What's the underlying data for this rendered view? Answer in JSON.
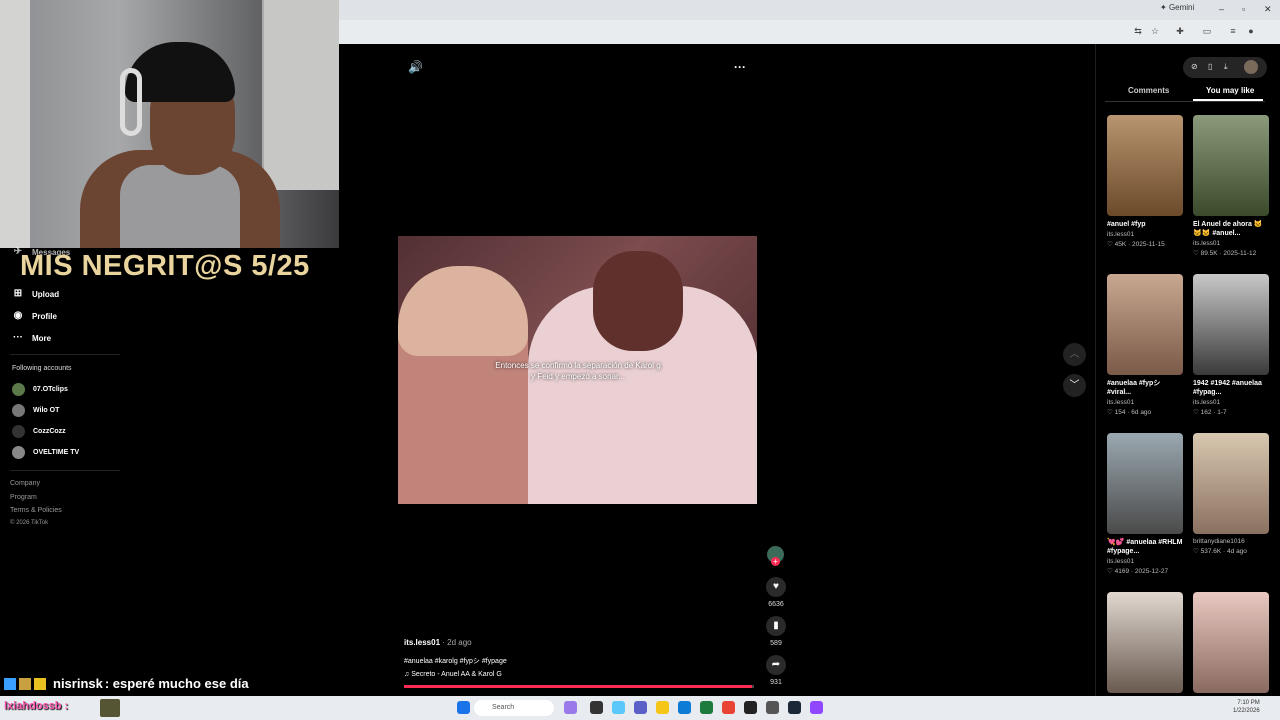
{
  "browser": {
    "gemini_label": "Gemini",
    "minimize": "–",
    "maximize": "▫",
    "close": "✕"
  },
  "stream": {
    "overlay_title": "MIS NEGRIT@S 5/25",
    "chat_user": "nisrinsk",
    "chat_message": ": esperé mucho ese día",
    "taskbar_user": "lxiahdossb :"
  },
  "sidebar": {
    "messages": "Messages",
    "items": [
      {
        "label": "Upload",
        "icon": "upload-icon"
      },
      {
        "label": "Profile",
        "icon": "avatar-icon"
      },
      {
        "label": "More",
        "icon": "more-icon"
      }
    ],
    "following_heading": "Following accounts",
    "accounts": [
      "07.OTclips",
      "Wilo OT",
      "CozzCozz",
      "OVELTIME TV"
    ],
    "footer": [
      "Company",
      "Program",
      "Terms & Policies",
      "© 2026 TikTok"
    ]
  },
  "video": {
    "caption": "Entonces se confirmó la separación de Karol g y Feid y empezó a sonar...",
    "author": "its.less01",
    "posted": "· 2d ago",
    "hashtags": "#anuelaa #karolg #fypシ #fypage",
    "music": "♫  Secreto - Anuel AA & Karol G",
    "progress": 0.995,
    "likes": "6636",
    "saves": "589",
    "shares": "931"
  },
  "right_panel": {
    "tabs": [
      "Comments",
      "You may like"
    ],
    "active_tab": "You may like",
    "cards": [
      {
        "title": "#anuel #fyp",
        "user": "its.less01",
        "likes": "45K",
        "date": "2025-11-15"
      },
      {
        "title": "El Anuel de ahora 🐱🐱🐱 #anuel...",
        "user": "its.less01",
        "likes": "89.5K",
        "date": "2025-11-12"
      },
      {
        "title": "#anuelaa #fypシ #viral...",
        "user": "its.less01",
        "likes": "154",
        "date": "6d ago"
      },
      {
        "title": "1942 #1942 #anuelaa #fypag...",
        "user": "its.less01",
        "likes": "162",
        "date": "1-7"
      },
      {
        "title": "💘💕 #anuelaa #RHLM #fypage...",
        "user": "its.less01",
        "likes": "4169",
        "date": "2025-12-27"
      },
      {
        "title": "",
        "user": "brittanydiane1016",
        "likes": "537.6K",
        "date": "4d ago"
      },
      {
        "title": "",
        "user": "",
        "likes": "",
        "date": ""
      },
      {
        "title": "",
        "user": "",
        "likes": "",
        "date": ""
      }
    ]
  },
  "taskbar": {
    "search_placeholder": "Search",
    "time": "7:10 PM",
    "date": "1/22/2026"
  },
  "colors": {
    "tiktok_red": "#fe2c55",
    "overlay_gold": "#e8d49c"
  }
}
